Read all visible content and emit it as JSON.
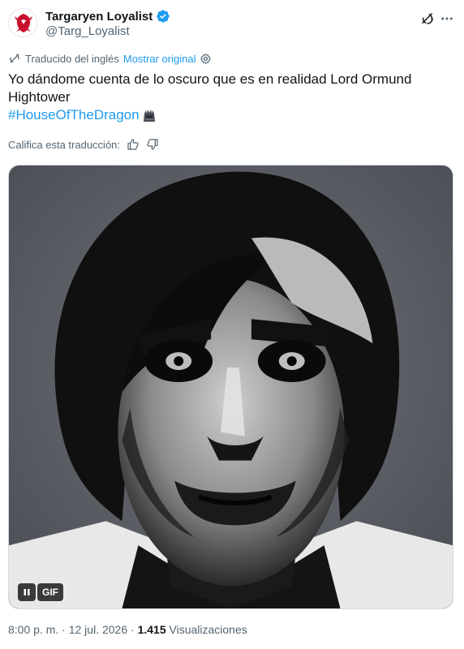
{
  "author": {
    "display_name": "Targaryen Loyalist",
    "handle": "@Targ_Loyalist",
    "verified": true,
    "avatar_icon": "house-targaryen-sigil-icon",
    "avatar_color": "#c8102e"
  },
  "translation": {
    "notice": "Traducido del inglés",
    "show_original": "Mostrar original"
  },
  "tweet": {
    "text": "Yo dándome cuenta de lo oscuro que es en realidad Lord Ormund Hightower",
    "hashtag": "#HouseOfTheDragon",
    "hashtag_emoji": "iron-throne-icon"
  },
  "rating": {
    "label": "Califica esta traducción:"
  },
  "media": {
    "type": "gif",
    "badge": "GIF",
    "description_icon": "dark-portrait-gif"
  },
  "meta": {
    "time": "8:00 p. m.",
    "separator": "·",
    "date": "12 jul. 2026",
    "views_count": "1.415",
    "views_label": "Visualizaciones"
  },
  "colors": {
    "accent": "#1d9bf0",
    "text_primary": "#0f1419",
    "text_secondary": "#536471"
  }
}
